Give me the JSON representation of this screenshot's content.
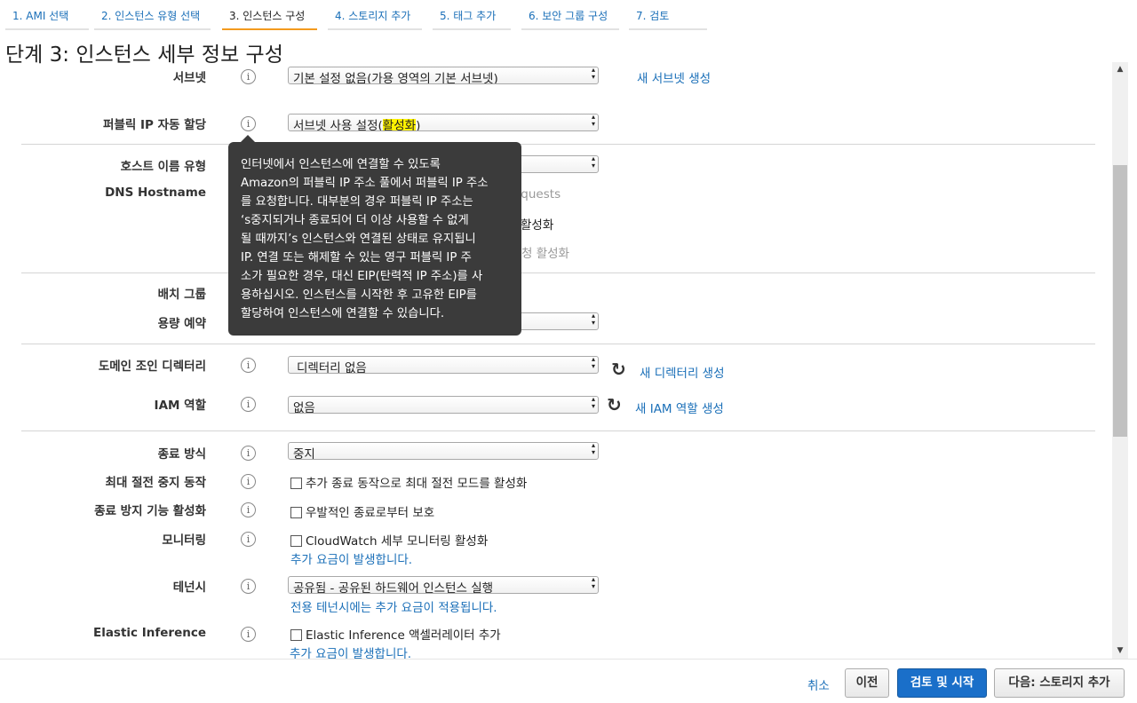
{
  "tabs": [
    {
      "label": "1. AMI 선택"
    },
    {
      "label": "2. 인스턴스 유형 선택"
    },
    {
      "label": "3. 인스턴스 구성"
    },
    {
      "label": "4. 스토리지 추가"
    },
    {
      "label": "5. 태그 추가"
    },
    {
      "label": "6. 보안 그룹 구성"
    },
    {
      "label": "7. 검토"
    }
  ],
  "page_title": "단계 3: 인스턴스 세부 정보 구성",
  "info_glyph": "i",
  "form": {
    "subnet": {
      "label": "서브넷",
      "value": "기본 설정 없음(가용 영역의 기본 서브넷)",
      "link": "새 서브넷 생성"
    },
    "public_ip": {
      "label": "퍼블릭 IP 자동 할당",
      "value_prefix": "서브넷 사용 설정(",
      "value_highlight": "활성화",
      "value_suffix": ")"
    },
    "hostname_type": {
      "label": "호스트 이름 유형"
    },
    "dns_hostname": {
      "label": "DNS Hostname",
      "partial_1": "equests",
      "partial_2": "활성화",
      "partial_3": "청 활성화"
    },
    "placement_group": {
      "label": "배치 그룹"
    },
    "capacity_reservation": {
      "label": "용량 예약"
    },
    "domain_join": {
      "label": "도메인 조인 디렉터리",
      "value": "디렉터리 없음",
      "link": "새 디렉터리 생성"
    },
    "iam_role": {
      "label": "IAM 역할",
      "value": "없음",
      "link": "새 IAM 역할 생성"
    },
    "shutdown": {
      "label": "종료 방식",
      "value": "중지"
    },
    "hibernate": {
      "label": "최대 절전 중지 동작",
      "checkbox": "추가 종료 동작으로 최대 절전 모드를 활성화"
    },
    "termination_protection": {
      "label": "종료 방지 기능 활성화",
      "checkbox": "우발적인 종료로부터 보호"
    },
    "monitoring": {
      "label": "모니터링",
      "checkbox": "CloudWatch 세부 모니터링 활성화",
      "note": "추가 요금이 발생합니다."
    },
    "tenancy": {
      "label": "테넌시",
      "value": "공유됨 - 공유된 하드웨어 인스턴스 실행",
      "note": "전용 테넌시에는 추가 요금이 적용됩니다."
    },
    "elastic_inference": {
      "label": "Elastic Inference",
      "checkbox": "Elastic Inference 액셀러레이터 추가",
      "note": "추가 요금이 발생합니다."
    }
  },
  "tooltip": {
    "lines": [
      "인터넷에서 인스턴스에 연결할 수 있도록",
      "Amazon의 퍼블릭 IP 주소 풀에서 퍼블릭 IP 주소",
      "를 요청합니다. 대부분의 경우 퍼블릭 IP 주소는",
      "‘s중지되거나 종료되어 더 이상 사용할 수 없게",
      "될 때까지’s 인스턴스와 연결된 상태로 유지됩니",
      "IP. 연결 또는 해제할 수 있는 영구 퍼블릭 IP 주",
      "소가 필요한 경우, 대신 EIP(탄력적 IP 주소)를 사",
      "용하십시오. 인스턴스를 시작한 후 고유한 EIP를",
      "할당하여 인스턴스에 연결할 수 있습니다."
    ]
  },
  "footer": {
    "cancel": "취소",
    "previous": "이전",
    "review_launch": "검토 및 시작",
    "next": "다음: 스토리지 추가"
  },
  "colors": {
    "accent": "#f39a1e",
    "link": "#1a6fb8",
    "primary_button": "#1a6fc9",
    "highlight": "#fff200"
  },
  "icons": {
    "refresh": "refresh-icon",
    "info": "info-icon"
  }
}
